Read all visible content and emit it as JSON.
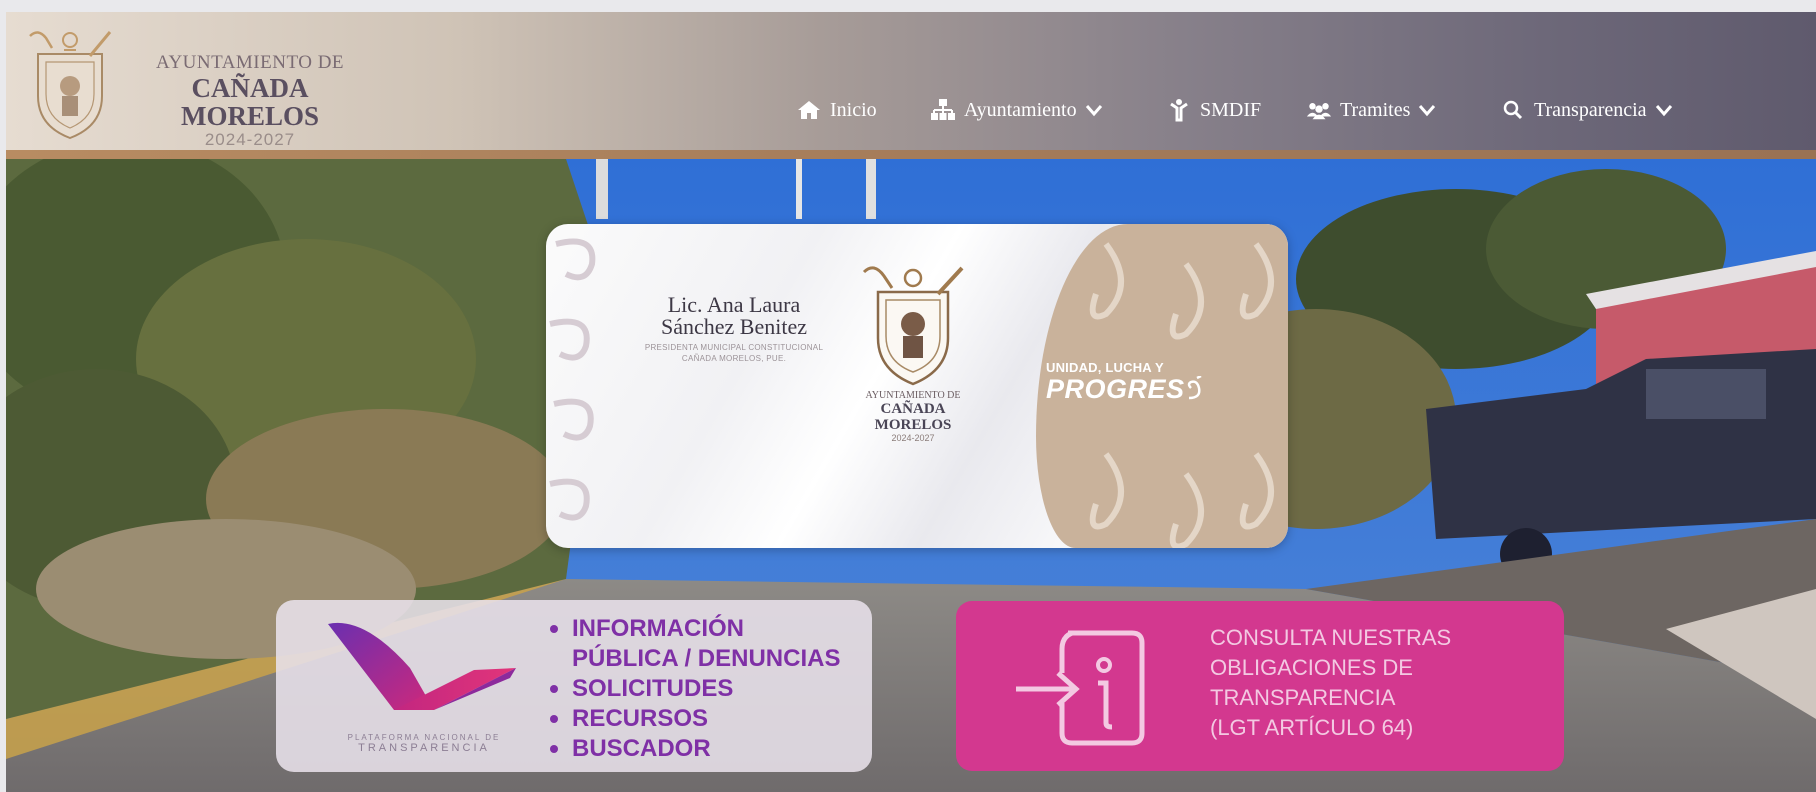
{
  "header": {
    "logo": {
      "line1": "AYUNTAMIENTO DE",
      "line2": "CAÑADA MORELOS",
      "line3": "2024-2027"
    },
    "nav": [
      {
        "label": "Inicio",
        "icon": "home-icon",
        "dropdown": false
      },
      {
        "label": "Ayuntamiento",
        "icon": "sitemap-icon",
        "dropdown": true
      },
      {
        "label": "SMDIF",
        "icon": "child-icon",
        "dropdown": false
      },
      {
        "label": "Tramites",
        "icon": "users-icon",
        "dropdown": true
      },
      {
        "label": "Transparencia",
        "icon": "search-icon",
        "dropdown": true
      }
    ]
  },
  "banner": {
    "name_line1": "Lic. Ana Laura",
    "name_line2": "Sánchez Benitez",
    "subtitle_line1": "PRESIDENTA MUNICIPAL CONSTITUCIONAL",
    "subtitle_line2": "CAÑADA MORELOS, PUE.",
    "ayto_line1": "AYUNTAMIENTO DE",
    "ayto_line2": "CAÑADA MORELOS",
    "ayto_line3": "2024-2027",
    "slogan_line1": "UNIDAD, LUCHA Y",
    "slogan_line2": "PROGRES"
  },
  "pnt": {
    "caption_line1": "PLATAFORMA NACIONAL DE",
    "caption_line2": "TRANSPARENCIA",
    "items": [
      {
        "text": "INFORMACIÓN",
        "bullet": true
      },
      {
        "text": "PÚBLICA / DENUNCIAS",
        "bullet": false
      },
      {
        "text": "SOLICITUDES",
        "bullet": true
      },
      {
        "text": "RECURSOS",
        "bullet": true
      },
      {
        "text": "BUSCADOR",
        "bullet": true
      }
    ]
  },
  "consulta": {
    "lines": [
      "CONSULTA NUESTRAS",
      "OBLIGACIONES DE",
      "TRANSPARENCIA",
      "(LGT ARTÍCULO 64)"
    ]
  },
  "colors": {
    "nav_text": "#ffffff",
    "header_rule": "#b88c62",
    "pnt_text": "#7f30a6",
    "consulta_bg": "#d3388f",
    "banner_tan": "#c9b29b"
  }
}
